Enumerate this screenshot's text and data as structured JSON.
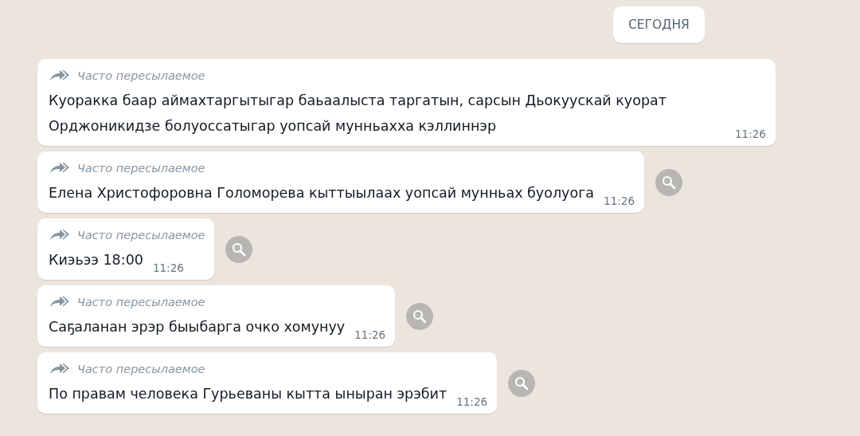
{
  "date_chip": "СЕГОДНЯ",
  "messages": [
    {
      "forwarded_label": "Часто пересылаемое",
      "text": "Куоракка баар аймахтаргытыгар баьаалыста таргатын, сарсын Дьокуускай куорат Орджоникидзе болуоссатыгар уопсай мунньахха кэллиннэр",
      "time": "11:26",
      "search_button": false
    },
    {
      "forwarded_label": "Часто пересылаемое",
      "text": "Елена Христофоровна Голоморева кыттыылаах уопсай мунньах буолуога",
      "time": "11:26",
      "search_button": true
    },
    {
      "forwarded_label": "Часто пересылаемое",
      "text": "Киэьээ 18:00",
      "time": "11:26",
      "search_button": true
    },
    {
      "forwarded_label": "Часто пересылаемое",
      "text": "Саҕаланан эрэр быыбарга очко хомунуу",
      "time": "11:26",
      "search_button": true
    },
    {
      "forwarded_label": "Часто пересылаемое",
      "text": "По правам человека Гурьеваны кытта ыныран эрэбит",
      "time": "11:26",
      "search_button": true
    }
  ]
}
